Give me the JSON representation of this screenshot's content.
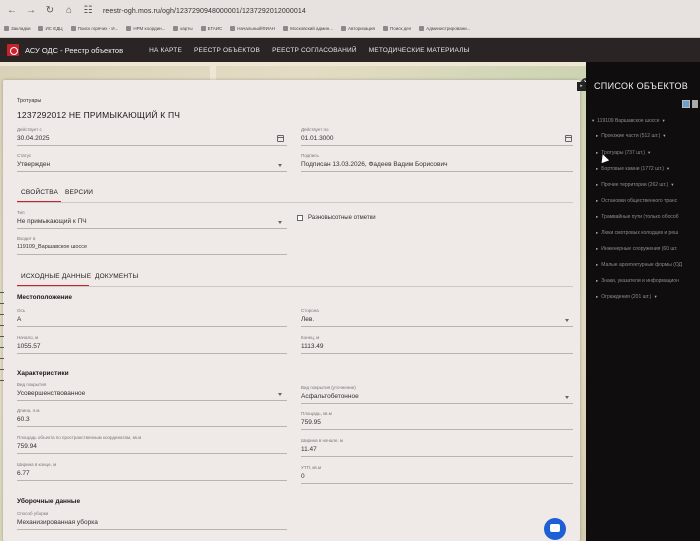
{
  "browser": {
    "url": "reestr-ogh.mos.ru/ogh/1237290948000001/1237292012000014",
    "bookmarks": [
      "Закладки",
      "ИС ЕДЦ",
      "Поиск горячих - И...",
      "НРМ координ...",
      "карты",
      "ЕГАИС",
      "Начальный/ФИАН",
      "Московский админ...",
      "Авторизация",
      "Поиск дел",
      "Администрировани..."
    ]
  },
  "app": {
    "title": "АСУ ОДС - Реестр объектов",
    "menu": [
      "НА КАРТЕ",
      "РЕЕСТР ОБЪЕКТОВ",
      "РЕЕСТР СОГЛАСОВАНИЙ",
      "МЕТОДИЧЕСКИЕ МАТЕРИАЛЫ"
    ]
  },
  "card": {
    "category": "Тротуары",
    "title": "1237292012 НЕ ПРИМЫКАЮЩИЙ К ПЧ",
    "valid_from_label": "Действует с",
    "valid_from": "30.04.2025",
    "valid_to_label": "Действует по",
    "valid_to": "01.01.3000",
    "status_label": "Статус",
    "status": "Утвержден",
    "sign_label": "Подпись",
    "sign": "Подписан 13.03.2026, Фадеев Вадим Борисович",
    "tabs": [
      "СВОЙСТВА",
      "ВЕРСИИ"
    ],
    "type_label": "Тип",
    "type": "Не примыкающий к ПЧ",
    "levels_label": "Разновысотные отметки",
    "part_of_label": "Входит в",
    "part_of": "119109_Варшавское шоссе",
    "subtabs": [
      "ИСХОДНЫЕ ДАННЫЕ",
      "ДОКУМЕНТЫ"
    ],
    "location_title": "Местоположение",
    "axis_label": "Ось",
    "axis": "А",
    "side_label": "Сторона",
    "side": "Лев.",
    "start_label": "Начало, м",
    "start": "1055.57",
    "end_label": "Конец, м",
    "end": "1113.49",
    "characteristics_title": "Характеристики",
    "cover_type_label": "Вид покрытия",
    "cover_type": "Усовершенствованное",
    "cover_type_spec_label": "Вид покрытия (уточнение)",
    "cover_type_spec": "Асфальтобетонное",
    "length_label": "Длина, п.м",
    "length": "60.3",
    "area_label": "Площадь, кв.м",
    "area": "759.95",
    "proj_area_label": "Площадь объекта по пространственным координатам, кв.м",
    "proj_area": "759.94",
    "width_begin_label": "Ширина в начале, м",
    "width_begin": "11.47",
    "width_end_label": "Ширина в конце, м",
    "width_end": "6.77",
    "utp_label": "УТП, кв.м",
    "utp": "0",
    "cleaning_title": "Уборочные данные",
    "cleaning_method_label": "Способ уборки",
    "cleaning_method": "Механизированная уборка"
  },
  "objects": {
    "title": "СПИСОК ОБЪЕКТОВ",
    "root": "119109 Варшавское шоссе",
    "items": [
      "Проезжие части (512 шт.)",
      "Тротуары (737 шт.)",
      "Бортовые камни (1772 шт.)",
      "Прочие территории (262 шт.)",
      "Остановки общественного транс",
      "Трамвайные пути (только обособ",
      "Люки смотровых колодцев и реш",
      "Инженерные сооружения (60 шт.",
      "Малые архитектурные формы (ОД",
      "Знаки, указатели и информацион",
      "Ограждения (201 шт.)"
    ]
  }
}
